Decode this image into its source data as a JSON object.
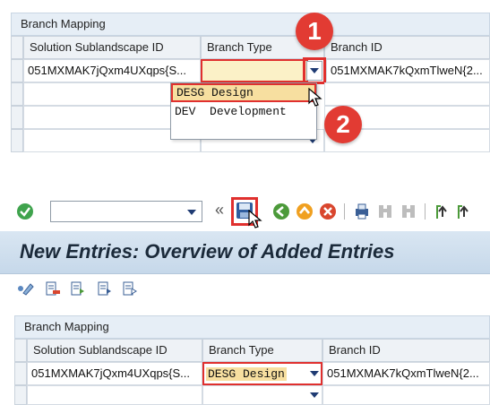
{
  "top_panel": {
    "title": "Branch Mapping",
    "columns": [
      "Solution Sublandscape ID",
      "Branch Type",
      "Branch ID"
    ],
    "row": {
      "sublandscape_id": "051MXMAK7jQxm4UXqps{S...",
      "branch_type": "",
      "branch_id": "051MXMAK7kQxmTlweN{2..."
    },
    "dropdown_options": [
      {
        "code": "DESG",
        "text": "Design"
      },
      {
        "code": "DEV",
        "text": "Development"
      }
    ],
    "callouts": [
      "1",
      "2"
    ]
  },
  "toolbar": {
    "command_field_value": "",
    "nav_back_label": "«"
  },
  "page": {
    "title": "New Entries: Overview of Added Entries"
  },
  "bottom_panel": {
    "title": "Branch Mapping",
    "columns": [
      "Solution Sublandscape ID",
      "Branch Type",
      "Branch ID"
    ],
    "row": {
      "sublandscape_id": "051MXMAK7jQxm4UXqps{S...",
      "branch_type": "DESG Design",
      "branch_id": "051MXMAK7kQxmTlweN{2..."
    }
  },
  "colors": {
    "highlight": "#e0302e",
    "selected_bg": "#f7dfa0",
    "header_bg": "#c6d8ea"
  }
}
